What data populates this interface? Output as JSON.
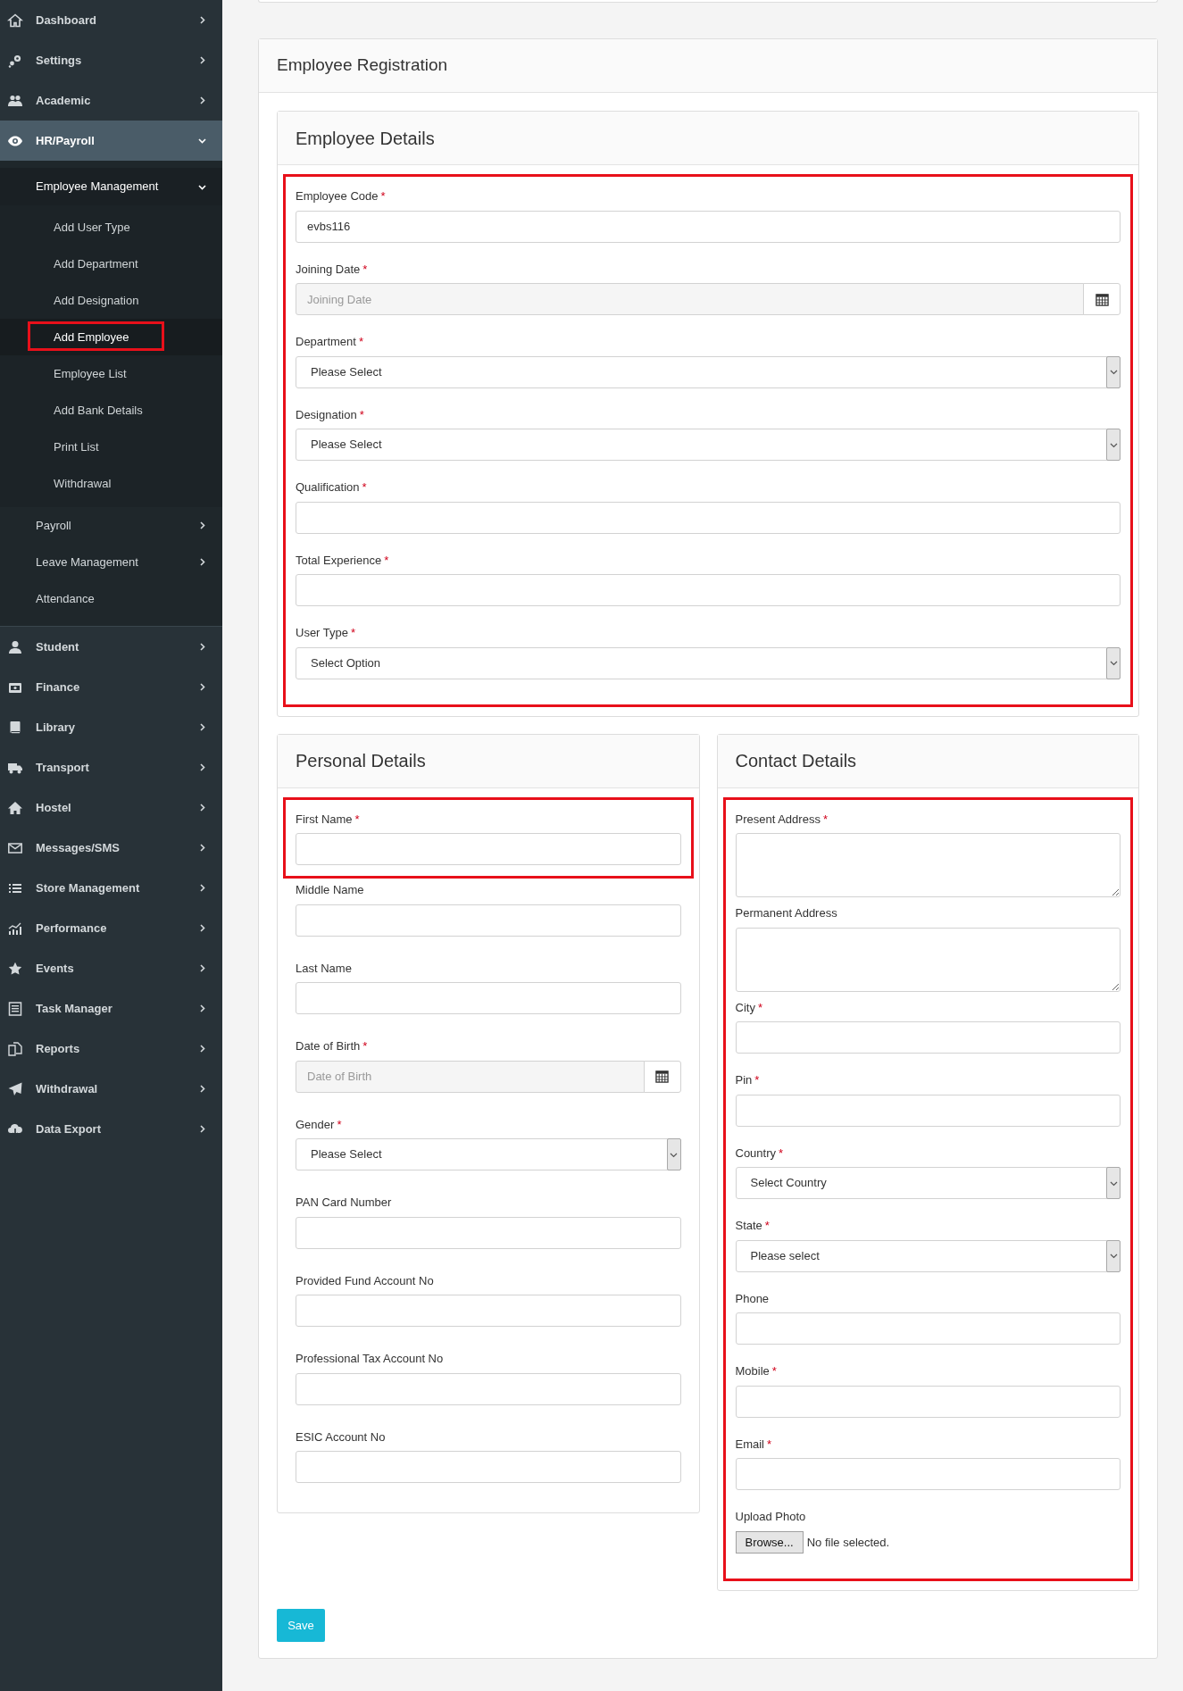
{
  "sidebar": {
    "items": [
      {
        "label": "Dashboard",
        "kind": "menu",
        "expanded": false
      },
      {
        "label": "Settings",
        "kind": "menu",
        "expanded": false
      },
      {
        "label": "Academic",
        "kind": "menu",
        "expanded": false
      },
      {
        "label": "HR/Payroll",
        "kind": "menu",
        "expanded": true,
        "children": [
          {
            "label": "Employee Management",
            "kind": "menu",
            "expanded": true,
            "children": [
              {
                "label": "Add User Type",
                "selected": false,
                "highlighted": false
              },
              {
                "label": "Add Department",
                "selected": false,
                "highlighted": false
              },
              {
                "label": "Add Designation",
                "selected": false,
                "highlighted": false
              },
              {
                "label": "Add Employee",
                "selected": true,
                "highlighted": true
              },
              {
                "label": "Employee List",
                "selected": false,
                "highlighted": false
              },
              {
                "label": "Add Bank Details",
                "selected": false,
                "highlighted": false
              },
              {
                "label": "Print List",
                "selected": false,
                "highlighted": false
              },
              {
                "label": "Withdrawal",
                "selected": false,
                "highlighted": false
              }
            ]
          },
          {
            "label": "Payroll",
            "kind": "menu",
            "expanded": false
          },
          {
            "label": "Leave Management",
            "kind": "menu",
            "expanded": false
          },
          {
            "label": "Attendance",
            "kind": "link"
          }
        ]
      },
      {
        "label": "Student",
        "kind": "menu",
        "expanded": false
      },
      {
        "label": "Finance",
        "kind": "menu",
        "expanded": false
      },
      {
        "label": "Library",
        "kind": "menu",
        "expanded": false
      },
      {
        "label": "Transport",
        "kind": "menu",
        "expanded": false
      },
      {
        "label": "Hostel",
        "kind": "menu",
        "expanded": false
      },
      {
        "label": "Messages/SMS",
        "kind": "menu",
        "expanded": false
      },
      {
        "label": "Store Management",
        "kind": "menu",
        "expanded": false
      },
      {
        "label": "Performance",
        "kind": "menu",
        "expanded": false
      },
      {
        "label": "Events",
        "kind": "menu",
        "expanded": false
      },
      {
        "label": "Task Manager",
        "kind": "menu",
        "expanded": false
      },
      {
        "label": "Reports",
        "kind": "menu",
        "expanded": false
      },
      {
        "label": "Withdrawal",
        "kind": "menu",
        "expanded": false
      },
      {
        "label": "Data Export",
        "kind": "menu",
        "expanded": false
      }
    ]
  },
  "form": {
    "title": "Employee Registration",
    "employee_details": {
      "title": "Employee Details",
      "highlighted": true,
      "fields": [
        {
          "label": "Employee Code",
          "required_mark": "*",
          "kind": "text",
          "value": "evbs116"
        },
        {
          "label": "Joining Date",
          "required_mark": "*",
          "kind": "date",
          "placeholder": "Joining Date"
        },
        {
          "label": "Department",
          "required_mark": "*",
          "kind": "select",
          "value": "Please Select"
        },
        {
          "label": "Designation",
          "required_mark": "*",
          "kind": "select",
          "value": "Please Select"
        },
        {
          "label": "Qualification",
          "required_mark": "*",
          "kind": "text"
        },
        {
          "label": "Total Experience",
          "required_mark": "*",
          "kind": "text"
        },
        {
          "label": "User Type",
          "required_mark": "*",
          "kind": "select",
          "value": "Select Option"
        }
      ]
    },
    "personal_details": {
      "title": "Personal Details",
      "fields": [
        {
          "label": "First Name",
          "required_mark": "*",
          "kind": "text",
          "highlighted": true
        },
        {
          "label": "Middle Name",
          "kind": "text",
          "highlighted": false
        },
        {
          "label": "Last Name",
          "kind": "text",
          "highlighted": false
        },
        {
          "label": "Date of Birth",
          "required_mark": "*",
          "kind": "date",
          "placeholder": "Date of Birth",
          "highlighted": false
        },
        {
          "label": "Gender",
          "required_mark": "*",
          "kind": "select",
          "value": "Please Select",
          "highlighted": false
        },
        {
          "label": "PAN Card Number",
          "kind": "text",
          "highlighted": false
        },
        {
          "label": "Provided Fund Account No",
          "kind": "text",
          "highlighted": false
        },
        {
          "label": "Professional Tax Account No",
          "kind": "text",
          "highlighted": false
        },
        {
          "label": "ESIC Account No",
          "kind": "text",
          "highlighted": false
        }
      ]
    },
    "contact_details": {
      "title": "Contact Details",
      "highlighted": true,
      "fields": [
        {
          "label": "Present Address",
          "required_mark": "*",
          "kind": "textarea"
        },
        {
          "label": "Permanent Address",
          "kind": "textarea"
        },
        {
          "label": "City",
          "required_mark": "*",
          "kind": "text"
        },
        {
          "label": "Pin",
          "required_mark": "*",
          "kind": "text"
        },
        {
          "label": "Country",
          "required_mark": "*",
          "kind": "select",
          "value": "Select Country"
        },
        {
          "label": "State",
          "required_mark": "*",
          "kind": "select",
          "value": "Please select"
        },
        {
          "label": "Phone",
          "kind": "text"
        },
        {
          "label": "Mobile",
          "required_mark": "*",
          "kind": "text"
        },
        {
          "label": "Email",
          "required_mark": "*",
          "kind": "text"
        },
        {
          "label": "Upload Photo",
          "kind": "file",
          "button": "Browse...",
          "status": "No file selected."
        }
      ]
    },
    "save_button": "Save"
  }
}
